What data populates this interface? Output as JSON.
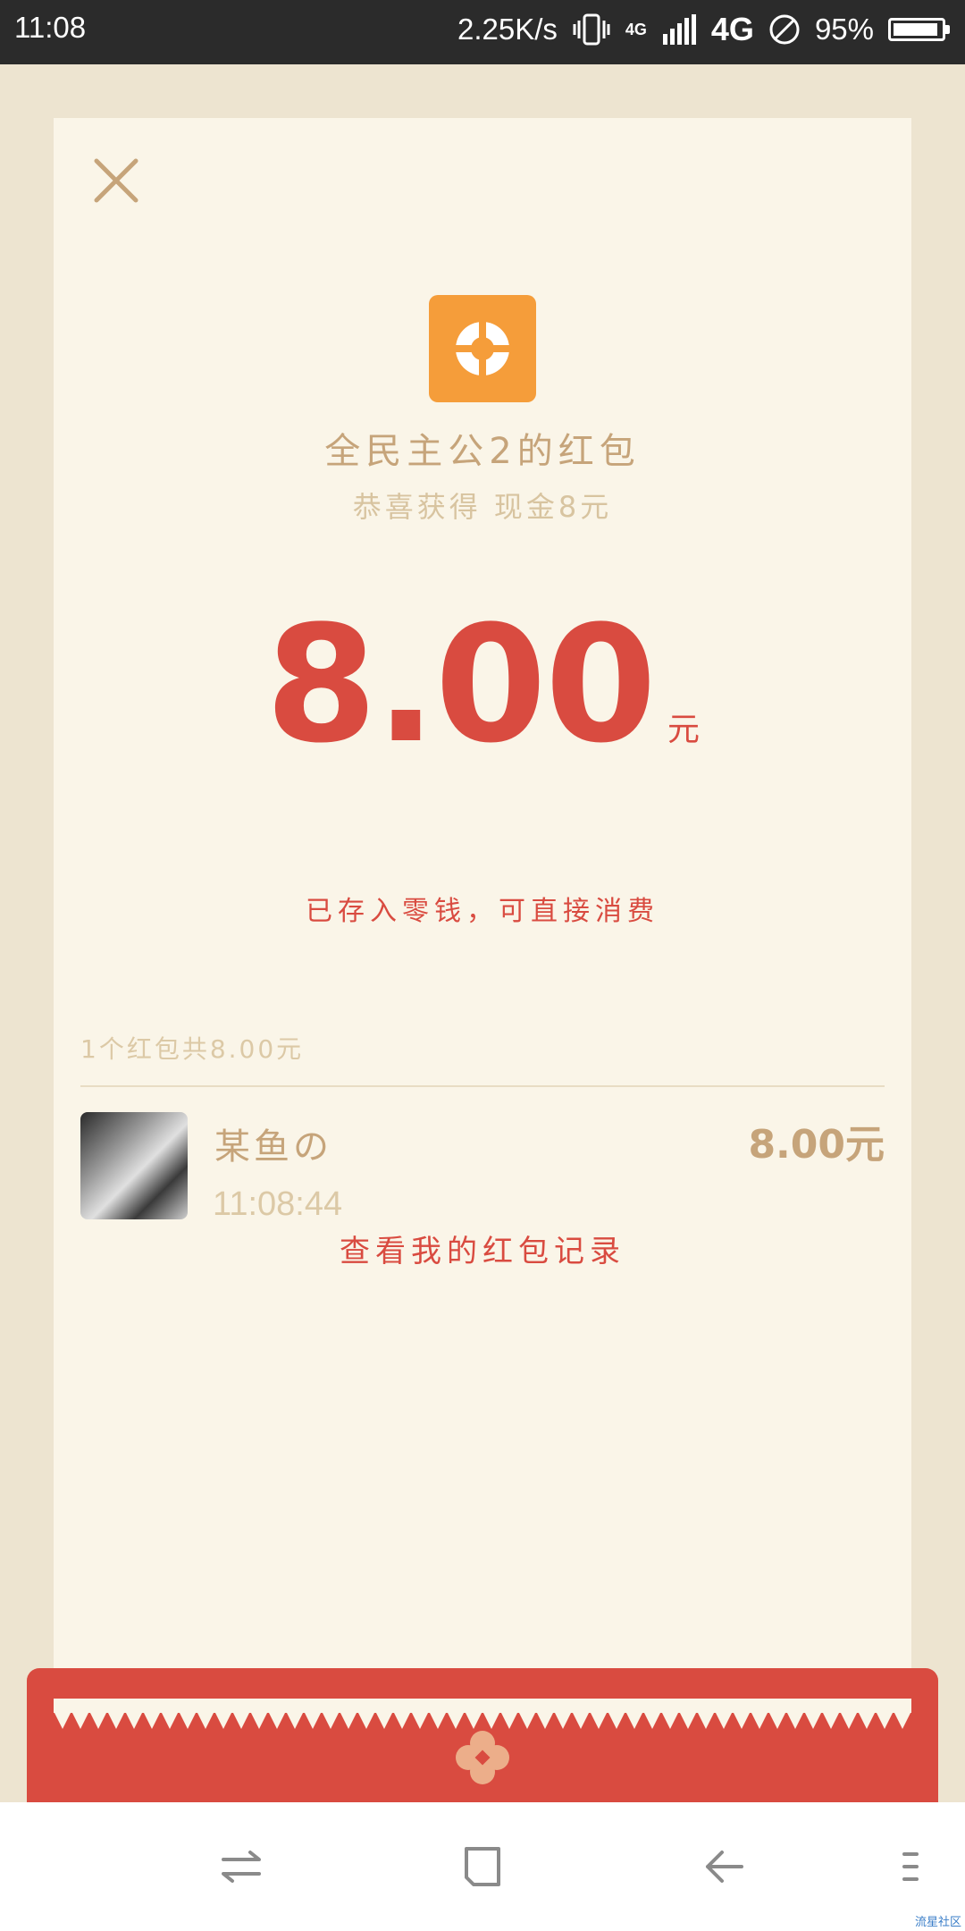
{
  "status_bar": {
    "time": "11:08",
    "net_speed": "2.25K/s",
    "net_type_small": "4G",
    "net_type": "4G",
    "battery": "95%",
    "battery_level": 0.95
  },
  "card": {
    "sender_title": "全民主公2的红包",
    "wish": "恭喜获得 现金8元",
    "amount": "8.00",
    "amount_unit": "元",
    "deposit_note": "已存入零钱，可直接消费",
    "summary": "1个红包共8.00元",
    "history_link": "查看我的红包记录"
  },
  "records": [
    {
      "name": "某鱼の",
      "time": "11:08:44",
      "amount": "8.00元"
    }
  ],
  "watermark": "流星社区",
  "colors": {
    "accent_red": "#d94b40",
    "gold": "#c6a47a",
    "logo_orange": "#f59d3a",
    "card_bg": "#faf5e8",
    "page_bg": "#ede4d0"
  },
  "icons": {
    "close": "close-icon",
    "logo": "app-logo-icon",
    "flower": "flower-icon",
    "nav": [
      "switch-apps-icon",
      "home-icon",
      "back-icon",
      "menu-icon"
    ]
  }
}
